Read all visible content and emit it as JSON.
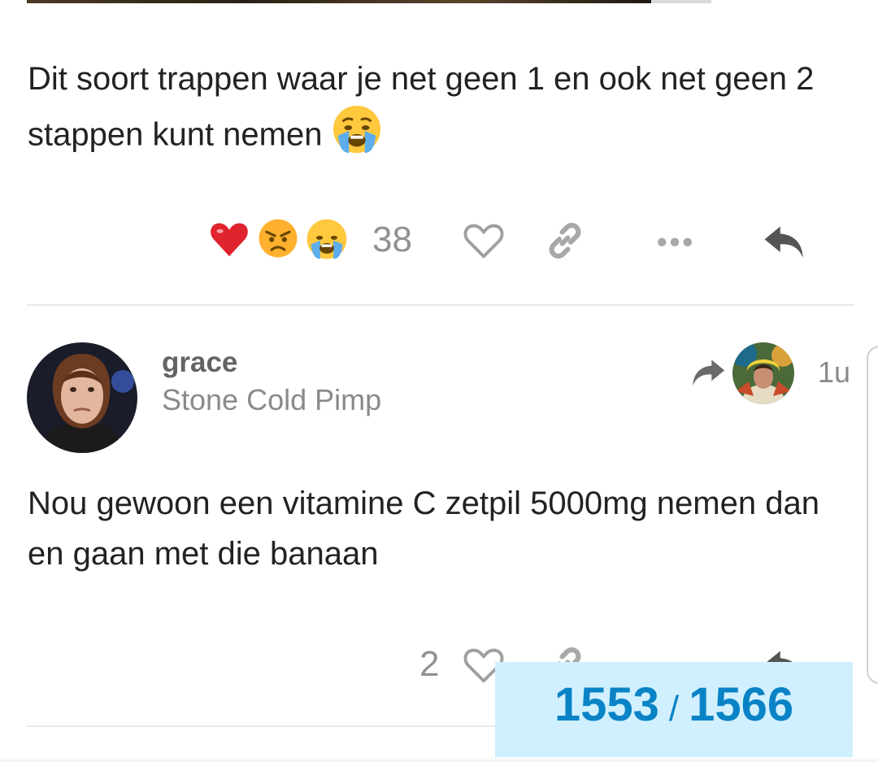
{
  "posts": [
    {
      "text": "Dit soort trappen waar je net geen 1 en ook net geen 2 stappen kunt nemen",
      "inline_emoji": "crying-face",
      "reactions": [
        "heart",
        "angry-face",
        "crying-face"
      ],
      "reaction_count": "38"
    },
    {
      "author": {
        "username": "grace",
        "title": "Stone Cold Pimp"
      },
      "reply_to": {
        "icon": "reply-arrow-icon"
      },
      "age": "1u",
      "text": "Nou gewoon een vitamine C zetpil 5000mg nemen dan en gaan met die banaan",
      "like_count": "2"
    }
  ],
  "progress": {
    "current": "1553",
    "separator": "/",
    "total": "1566"
  },
  "colors": {
    "text": "#222222",
    "muted": "#919191",
    "progress_bg": "#d1f0ff",
    "progress_text": "#0a83c6",
    "divider": "#e9e9e9"
  }
}
